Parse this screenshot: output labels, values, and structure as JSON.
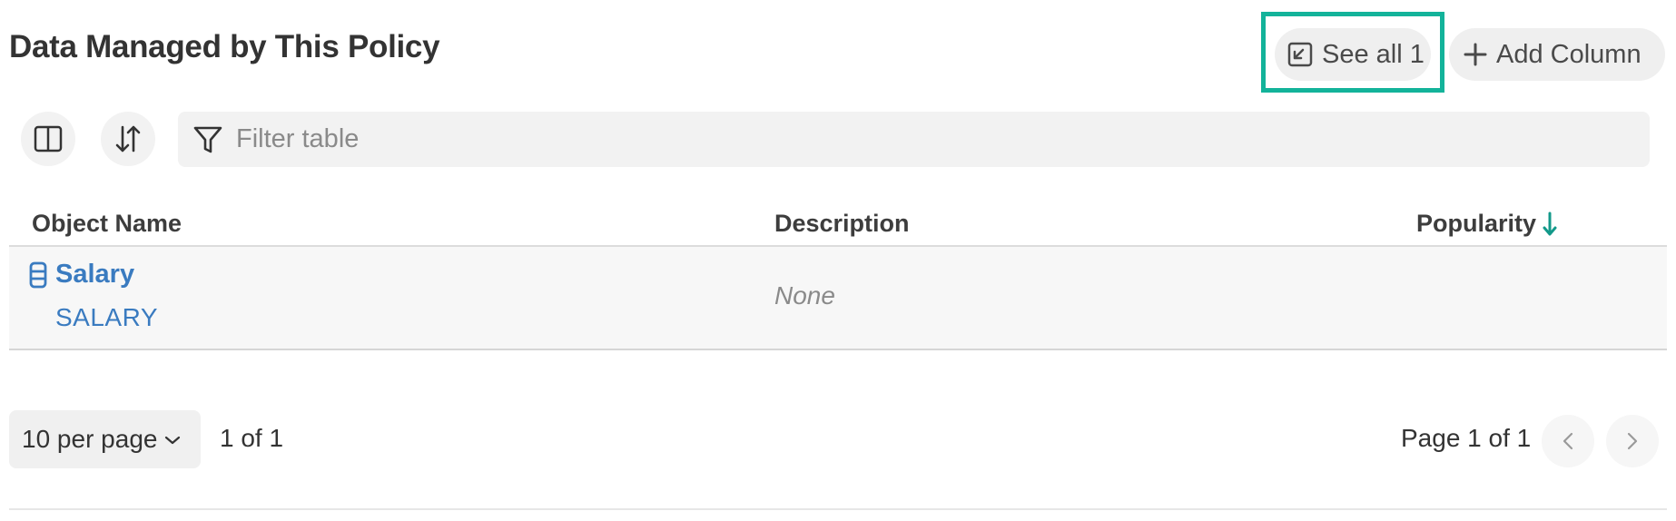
{
  "page_title": "Data Managed by This Policy",
  "actions": {
    "see_all_label": "See all 1",
    "add_column_label": "Add Column"
  },
  "toolbar": {
    "filter_placeholder": "Filter table",
    "columns_icon": "columns-icon",
    "sort_icon": "sort-icon",
    "filter_icon": "filter-icon"
  },
  "table": {
    "columns": [
      "Object Name",
      "Description",
      "Popularity"
    ],
    "sorted_by": "Popularity",
    "sort_direction": "descending",
    "rows": [
      {
        "name": "Salary",
        "subtitle": "SALARY",
        "description": "None",
        "icon": "table-icon"
      }
    ]
  },
  "pagination": {
    "per_page_label": "10 per page",
    "range_label": "1 of 1",
    "page_label": "Page 1 of 1"
  },
  "colors": {
    "accent": "#13b39a",
    "link": "#3a7bc0",
    "sort_arrow": "#13998a"
  }
}
